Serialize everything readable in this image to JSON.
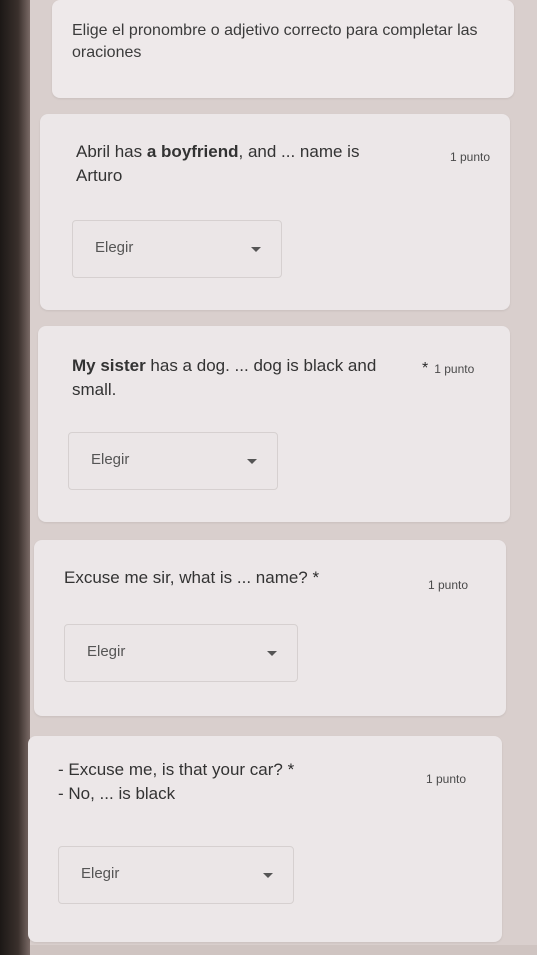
{
  "form": {
    "description": "Elige el pronombre o adjetivo correcto para completar las oraciones"
  },
  "questions": [
    {
      "pre": "Abril has ",
      "bold": "a boyfriend",
      "post": ", and ... name is Arturo",
      "points": "1 punto",
      "select": "Elegir"
    },
    {
      "bold": "My sister",
      "post": " has a dog. ... dog is black and small.",
      "required": "*",
      "points": "1 punto",
      "select": "Elegir"
    },
    {
      "text": "Excuse me sir, what is ... name?",
      "required": "*",
      "points": "1 punto",
      "select": "Elegir"
    },
    {
      "line1": "- Excuse me, is that your car?",
      "line2": "- No, ... is black",
      "required": "*",
      "points": "1 punto",
      "select": "Elegir"
    }
  ]
}
